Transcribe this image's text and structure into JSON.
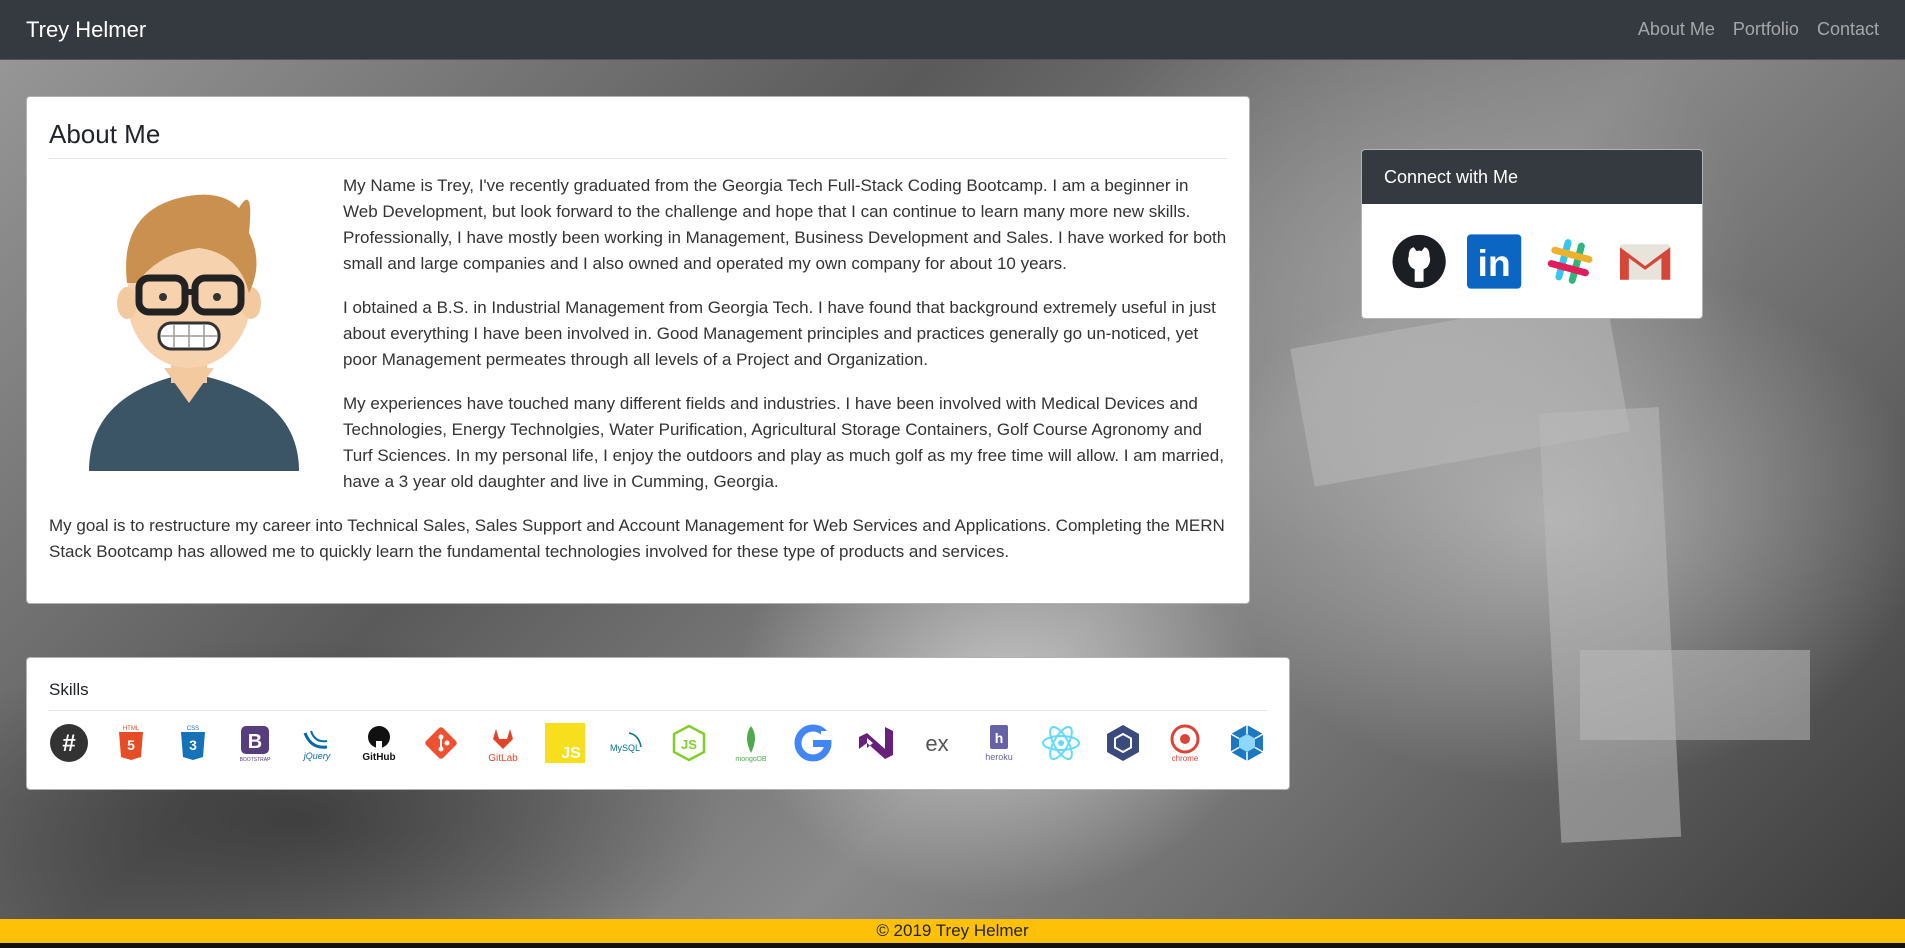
{
  "navbar": {
    "brand": "Trey Helmer",
    "links": [
      "About Me",
      "Portfolio",
      "Contact"
    ]
  },
  "about": {
    "title": "About Me",
    "paragraphs": [
      "My Name is Trey, I've recently graduated from the Georgia Tech Full-Stack Coding Bootcamp. I am a beginner in Web Development, but look forward to the challenge and hope that I can continue to learn many more new skills. Professionally, I have mostly been working in Management, Business Development and Sales. I have worked for both small and large companies and I also owned and operated my own company for about 10 years.",
      "I obtained a B.S. in Industrial Management from Georgia Tech. I have found that background extremely useful in just about everything I have been involved in. Good Management principles and practices generally go un-noticed, yet poor Management permeates through all levels of a Project and Organization.",
      "My experiences have touched many different fields and industries. I have been involved with Medical Devices and Technologies, Energy Technolgies, Water Purification, Agricultural Storage Containers, Golf Course Agronomy and Turf Sciences. In my personal life, I enjoy the outdoors and play as much golf as my free time will allow. I am married, have a 3 year old daughter and live in Cumming, Georgia."
    ],
    "goal": "My goal is to restructure my career into Technical Sales, Sales Support and Account Management for Web Services and Applications. Completing the MERN Stack Bootcamp has allowed me to quickly learn the fundamental technologies involved for these type of products and services."
  },
  "connect": {
    "title": "Connect with Me",
    "icons": [
      "github-icon",
      "linkedin-icon",
      "slack-icon",
      "gmail-icon"
    ],
    "linkedin_label": "in"
  },
  "skills": {
    "title": "Skills",
    "icons": [
      "slack-icon",
      "html5-icon",
      "css3-icon",
      "bootstrap-icon",
      "jquery-icon",
      "github-icon",
      "git-icon",
      "gitlab-icon",
      "javascript-icon",
      "mysql-icon",
      "nodejs-icon",
      "mongodb-icon",
      "google-icon",
      "visual-studio-icon",
      "express-icon",
      "heroku-icon",
      "react-icon",
      "webpack-icon",
      "chrome-icon",
      "webpack-icon"
    ],
    "labels": {
      "html": "HTML",
      "css": "CSS",
      "bootstrap": "B",
      "bootstrap_sub": "BOOTSTRAP",
      "jquery": "jQuery",
      "github": "GitHub",
      "gitlab": "GitLab",
      "js": "JS",
      "mysql": "MySQL",
      "mongodb": "mongoDB",
      "express": "ex",
      "heroku": "heroku",
      "chrome": "chrome"
    },
    "colors": {
      "html5": "#e44d26",
      "css3": "#1572b6",
      "bootstrap": "#563d7c",
      "git": "#f05032",
      "gitlab": "#e24329",
      "javascript": "#f7df1e",
      "nodejs": "#83cd29",
      "mongodb": "#4fa94d",
      "heroku": "#6762a6",
      "react": "#61dafb",
      "webpack": "#1c78c0"
    }
  },
  "footer": {
    "text": "© 2019 Trey Helmer",
    "color": "#ffc107"
  }
}
